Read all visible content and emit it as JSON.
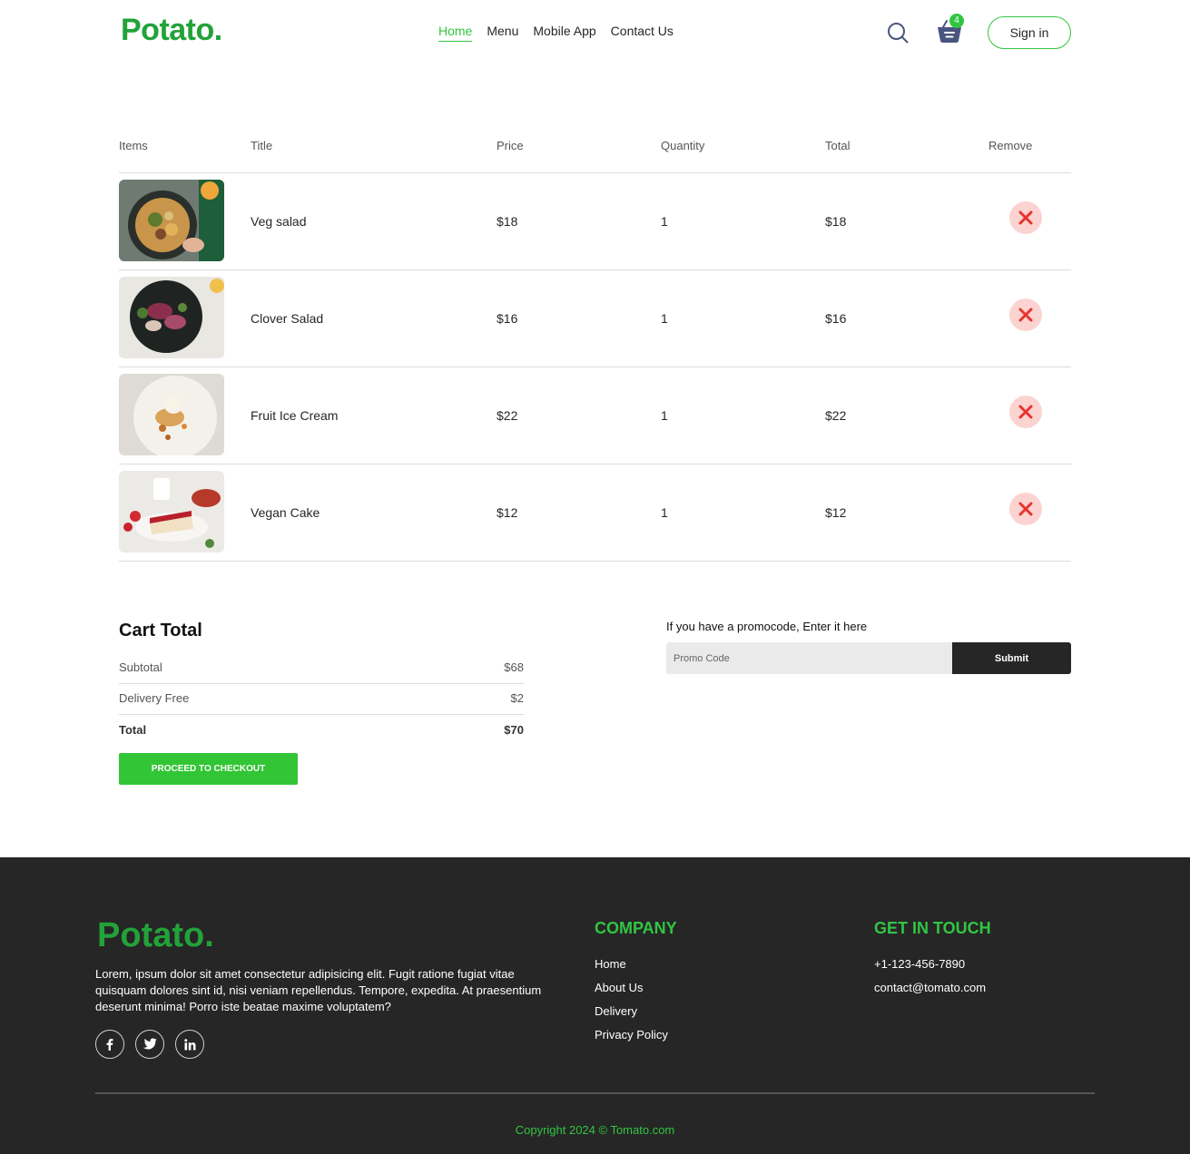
{
  "header": {
    "logo": "Potato.",
    "nav": [
      "Home",
      "Menu",
      "Mobile App",
      "Contact Us"
    ],
    "active_nav": "Home",
    "cart_count": "4",
    "signin_label": "Sign in"
  },
  "cart": {
    "columns": [
      "Items",
      "Title",
      "Price",
      "Quantity",
      "Total",
      "Remove"
    ],
    "rows": [
      {
        "title": "Veg salad",
        "price": "$18",
        "quantity": "1",
        "total": "$18"
      },
      {
        "title": "Clover Salad",
        "price": "$16",
        "quantity": "1",
        "total": "$16"
      },
      {
        "title": "Fruit Ice Cream",
        "price": "$22",
        "quantity": "1",
        "total": "$22"
      },
      {
        "title": "Vegan Cake",
        "price": "$12",
        "quantity": "1",
        "total": "$12"
      }
    ]
  },
  "summary": {
    "title": "Cart Total",
    "subtotal_label": "Subtotal",
    "subtotal_value": "$68",
    "delivery_label": "Delivery Free",
    "delivery_value": "$2",
    "total_label": "Total",
    "total_value": "$70",
    "checkout_label": "PROCEED TO CHECKOUT"
  },
  "promo": {
    "label": "If you have a promocode, Enter it here",
    "placeholder": "Promo Code",
    "submit_label": "Submit"
  },
  "footer": {
    "logo": "Potato.",
    "description": "Lorem, ipsum dolor sit amet consectetur adipisicing elit. Fugit ratione fugiat vitae quisquam dolores sint id, nisi veniam repellendus. Tempore, expedita. At praesentium deserunt minima! Porro iste beatae maxime voluptatem?",
    "company_heading": "COMPANY",
    "company_links": [
      "Home",
      "About Us",
      "Delivery",
      "Privacy Policy"
    ],
    "contact_heading": "GET IN TOUCH",
    "phone": "+1-123-456-7890",
    "email": "contact@tomato.com",
    "copyright": "Copyright 2024 © Tomato.com"
  },
  "colors": {
    "brand_green": "#22a239",
    "accent_green": "#32c543",
    "remove_bg": "#fbd3d1",
    "remove_icon": "#e8332c",
    "footer_bg": "#262626"
  }
}
